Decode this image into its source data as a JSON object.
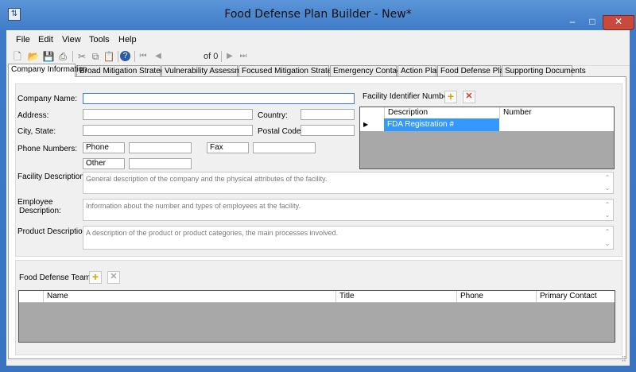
{
  "window": {
    "title": "Food Defense Plan Builder - New*",
    "minimize": "–",
    "maximize": "□",
    "close": "✕"
  },
  "menu": {
    "file": "File",
    "edit": "Edit",
    "view": "View",
    "tools": "Tools",
    "help": "Help"
  },
  "toolbar": {
    "position_value": "0",
    "of_label": "of 0"
  },
  "tabs": [
    {
      "label": "Company Information",
      "active": true
    },
    {
      "label": "Broad Mitigation Strategies"
    },
    {
      "label": "Vulnerability Assessment"
    },
    {
      "label": "Focused Mitigation Strategies"
    },
    {
      "label": "Emergency Contacts"
    },
    {
      "label": "Action Plan"
    },
    {
      "label": "Food Defense Plan"
    },
    {
      "label": "Supporting Documents"
    }
  ],
  "company": {
    "company_name_label": "Company Name:",
    "company_name_value": "",
    "address_label": "Address:",
    "country_label": "Country:",
    "city_state_label": "City, State:",
    "postal_code_label": "Postal Code:",
    "phone_numbers_label": "Phone Numbers:",
    "phone_type_1": "Phone",
    "phone_type_2": "Fax",
    "phone_type_3": "Other",
    "facility_description_label": "Facility Description:",
    "facility_description_placeholder": "General description of the company and the physical attributes of the facility.",
    "employee_description_label_1": "Employee",
    "employee_description_label_2": "Description:",
    "employee_description_placeholder": "Information about the number and types of employees at the facility.",
    "product_description_label": "Product Description:",
    "product_description_placeholder": "A description of the product or product categories, the main processes involved."
  },
  "facility_ids": {
    "label": "Facility Identifier Numbers:",
    "columns": [
      "Description",
      "Number"
    ],
    "rows": [
      {
        "description": "FDA Registration #",
        "number": ""
      }
    ],
    "row_marker": "▶"
  },
  "team": {
    "label": "Food Defense Team:",
    "columns": [
      "Name",
      "Title",
      "Phone",
      "Primary Contact"
    ]
  },
  "icons": {
    "add": "+",
    "remove": "✕"
  },
  "colors": {
    "selection": "#3399ff",
    "close_button": "#c74a3c",
    "add_icon": "#e0a000",
    "remove_icon": "#d43a2a"
  }
}
